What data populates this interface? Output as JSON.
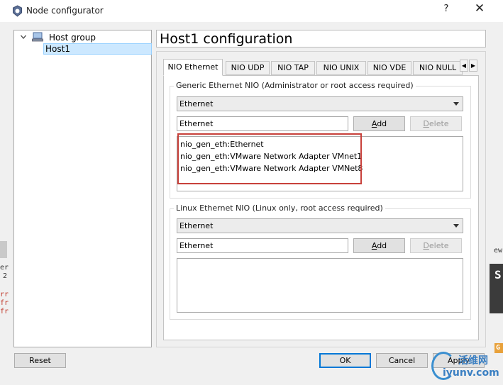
{
  "window": {
    "title": "Node configurator",
    "help_label": "?",
    "close_label": "✕"
  },
  "tree": {
    "group_label": "Host group",
    "selected_item": "Host1"
  },
  "config": {
    "title": "Host1 configuration"
  },
  "tabs": [
    {
      "label": "NIO Ethernet",
      "active": true
    },
    {
      "label": "NIO UDP"
    },
    {
      "label": "NIO TAP"
    },
    {
      "label": "NIO UNIX"
    },
    {
      "label": "NIO VDE"
    },
    {
      "label": "NIO NULL"
    }
  ],
  "tab_scroll": {
    "left": "◀",
    "right": "▶"
  },
  "generic": {
    "legend": "Generic Ethernet NIO (Administrator or root access required)",
    "combo_value": "Ethernet",
    "input_value": "Ethernet",
    "add_label": "Add",
    "delete_label": "Delete",
    "items": [
      "nio_gen_eth:Ethernet",
      "nio_gen_eth:VMware Network Adapter VMnet1",
      "nio_gen_eth:VMware Network Adapter VMNet8"
    ]
  },
  "linux": {
    "legend": "Linux Ethernet NIO (Linux only, root access required)",
    "combo_value": "Ethernet",
    "input_value": "Ethernet",
    "add_label": "Add",
    "delete_label": "Delete"
  },
  "footer": {
    "reset_label": "Reset",
    "ok_label": "OK",
    "cancel_label": "Cancel",
    "apply_label": "Apply"
  },
  "background": {
    "left_chars": [
      "er",
      "2",
      "rr",
      "fr",
      "fr"
    ],
    "right_chars": [
      "ew",
      "S",
      "G"
    ]
  },
  "watermark": {
    "cn": "活维网",
    "en": "iyunv.com"
  },
  "colors": {
    "highlight": "#c8413b",
    "selection": "#cce8ff",
    "primary_border": "#0078d7"
  }
}
